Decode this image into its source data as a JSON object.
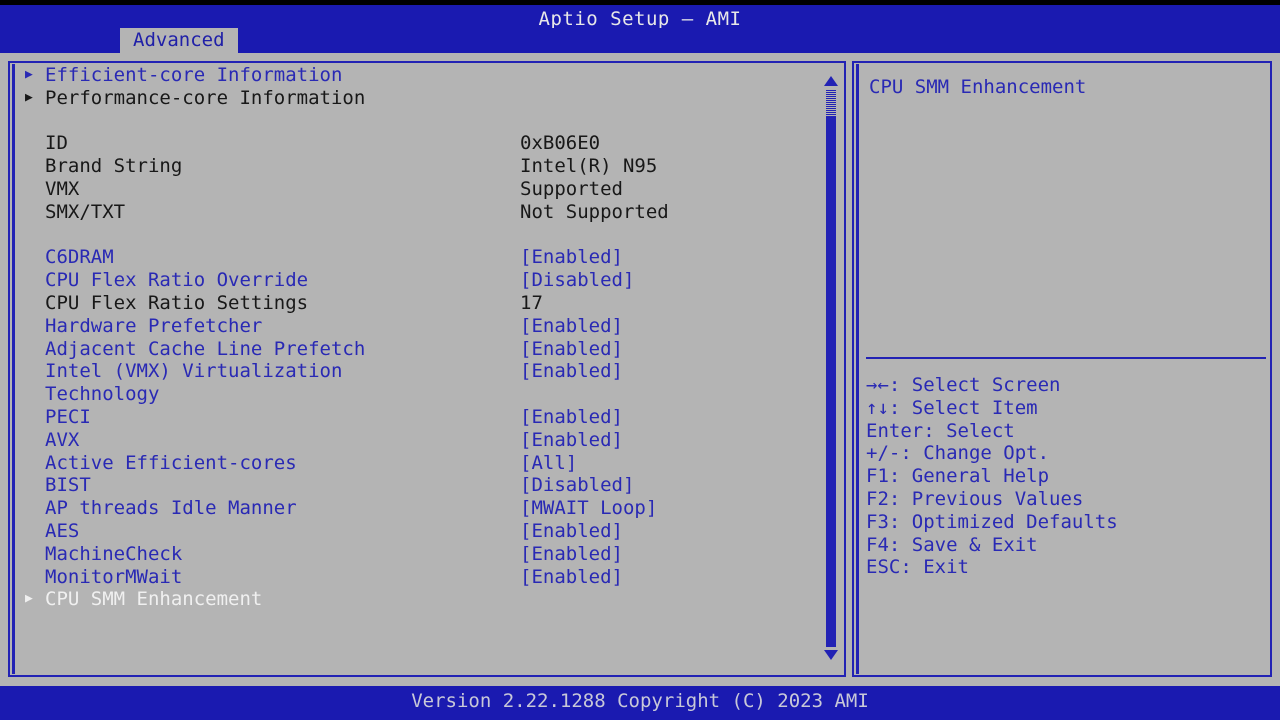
{
  "window": {
    "title": "Aptio Setup – AMI"
  },
  "tabs": [
    {
      "label": "Advanced",
      "active": true
    }
  ],
  "menu": {
    "rows": [
      {
        "arrow": "▶",
        "arrow_color": "blue",
        "label": "Efficient-core Information",
        "label_color": "blue",
        "value": "",
        "value_color": "blue"
      },
      {
        "arrow": "▶",
        "arrow_color": "dark",
        "label": "Performance-core Information",
        "label_color": "dark",
        "value": "",
        "value_color": "dark"
      },
      {
        "arrow": "",
        "arrow_color": "dark",
        "label": "",
        "label_color": "dark",
        "value": "",
        "value_color": "dark"
      },
      {
        "arrow": "",
        "arrow_color": "dark",
        "label": "ID",
        "label_color": "dark",
        "value": "0xB06E0",
        "value_color": "dark"
      },
      {
        "arrow": "",
        "arrow_color": "dark",
        "label": "Brand String",
        "label_color": "dark",
        "value": "Intel(R) N95",
        "value_color": "dark"
      },
      {
        "arrow": "",
        "arrow_color": "dark",
        "label": "VMX",
        "label_color": "dark",
        "value": "Supported",
        "value_color": "dark"
      },
      {
        "arrow": "",
        "arrow_color": "dark",
        "label": "SMX/TXT",
        "label_color": "dark",
        "value": "Not Supported",
        "value_color": "dark"
      },
      {
        "arrow": "",
        "arrow_color": "dark",
        "label": "",
        "label_color": "dark",
        "value": "",
        "value_color": "dark"
      },
      {
        "arrow": "",
        "arrow_color": "blue",
        "label": "C6DRAM",
        "label_color": "blue",
        "value": "[Enabled]",
        "value_color": "blue"
      },
      {
        "arrow": "",
        "arrow_color": "blue",
        "label": "CPU Flex Ratio Override",
        "label_color": "blue",
        "value": "[Disabled]",
        "value_color": "blue"
      },
      {
        "arrow": "",
        "arrow_color": "dark",
        "label": "CPU Flex Ratio Settings",
        "label_color": "dark",
        "value": "17",
        "value_color": "dark"
      },
      {
        "arrow": "",
        "arrow_color": "blue",
        "label": "Hardware Prefetcher",
        "label_color": "blue",
        "value": "[Enabled]",
        "value_color": "blue"
      },
      {
        "arrow": "",
        "arrow_color": "blue",
        "label": "Adjacent Cache Line Prefetch",
        "label_color": "blue",
        "value": "[Enabled]",
        "value_color": "blue"
      },
      {
        "arrow": "",
        "arrow_color": "blue",
        "label": "Intel (VMX) Virtualization",
        "label_color": "blue",
        "value": "[Enabled]",
        "value_color": "blue"
      },
      {
        "arrow": "",
        "arrow_color": "blue",
        "label": "Technology",
        "label_color": "blue",
        "value": "",
        "value_color": "blue"
      },
      {
        "arrow": "",
        "arrow_color": "blue",
        "label": "PECI",
        "label_color": "blue",
        "value": "[Enabled]",
        "value_color": "blue"
      },
      {
        "arrow": "",
        "arrow_color": "blue",
        "label": "AVX",
        "label_color": "blue",
        "value": "[Enabled]",
        "value_color": "blue"
      },
      {
        "arrow": "",
        "arrow_color": "blue",
        "label": "Active Efficient-cores",
        "label_color": "blue",
        "value": "[All]",
        "value_color": "blue"
      },
      {
        "arrow": "",
        "arrow_color": "blue",
        "label": "BIST",
        "label_color": "blue",
        "value": "[Disabled]",
        "value_color": "blue"
      },
      {
        "arrow": "",
        "arrow_color": "blue",
        "label": "AP threads Idle Manner",
        "label_color": "blue",
        "value": "[MWAIT Loop]",
        "value_color": "blue"
      },
      {
        "arrow": "",
        "arrow_color": "blue",
        "label": "AES",
        "label_color": "blue",
        "value": "[Enabled]",
        "value_color": "blue"
      },
      {
        "arrow": "",
        "arrow_color": "blue",
        "label": "MachineCheck",
        "label_color": "blue",
        "value": "[Enabled]",
        "value_color": "blue"
      },
      {
        "arrow": "",
        "arrow_color": "blue",
        "label": "MonitorMWait",
        "label_color": "blue",
        "value": "[Enabled]",
        "value_color": "blue"
      },
      {
        "arrow": "▶",
        "arrow_color": "white",
        "label": "CPU SMM Enhancement",
        "label_color": "white",
        "value": "",
        "value_color": "white"
      }
    ]
  },
  "scrollbar": {
    "up_arrow": "▲",
    "down_arrow": "▼"
  },
  "help": {
    "title": "CPU SMM Enhancement",
    "description": "",
    "keys": [
      {
        "glyph": "→←",
        "text": ": Select Screen"
      },
      {
        "glyph": "↑↓",
        "text": ": Select Item"
      },
      {
        "glyph": "Enter",
        "text": ": Select"
      },
      {
        "glyph": "+/-",
        "text": ": Change Opt."
      },
      {
        "glyph": "F1",
        "text": ": General Help"
      },
      {
        "glyph": "F2",
        "text": ": Previous Values"
      },
      {
        "glyph": "F3",
        "text": ": Optimized Defaults"
      },
      {
        "glyph": "F4",
        "text": ": Save & Exit"
      },
      {
        "glyph": "ESC",
        "text": ": Exit"
      }
    ]
  },
  "footer": {
    "version_text": "Version 2.22.1288 Copyright (C) 2023 AMI"
  },
  "colors": {
    "bios_blue": "#1a1ab0",
    "panel_gray": "#b4b4b4",
    "text_blue": "#2929b4",
    "text_dark": "#181818",
    "text_white": "#f0f0f0",
    "border_blue": "#2222b4"
  }
}
